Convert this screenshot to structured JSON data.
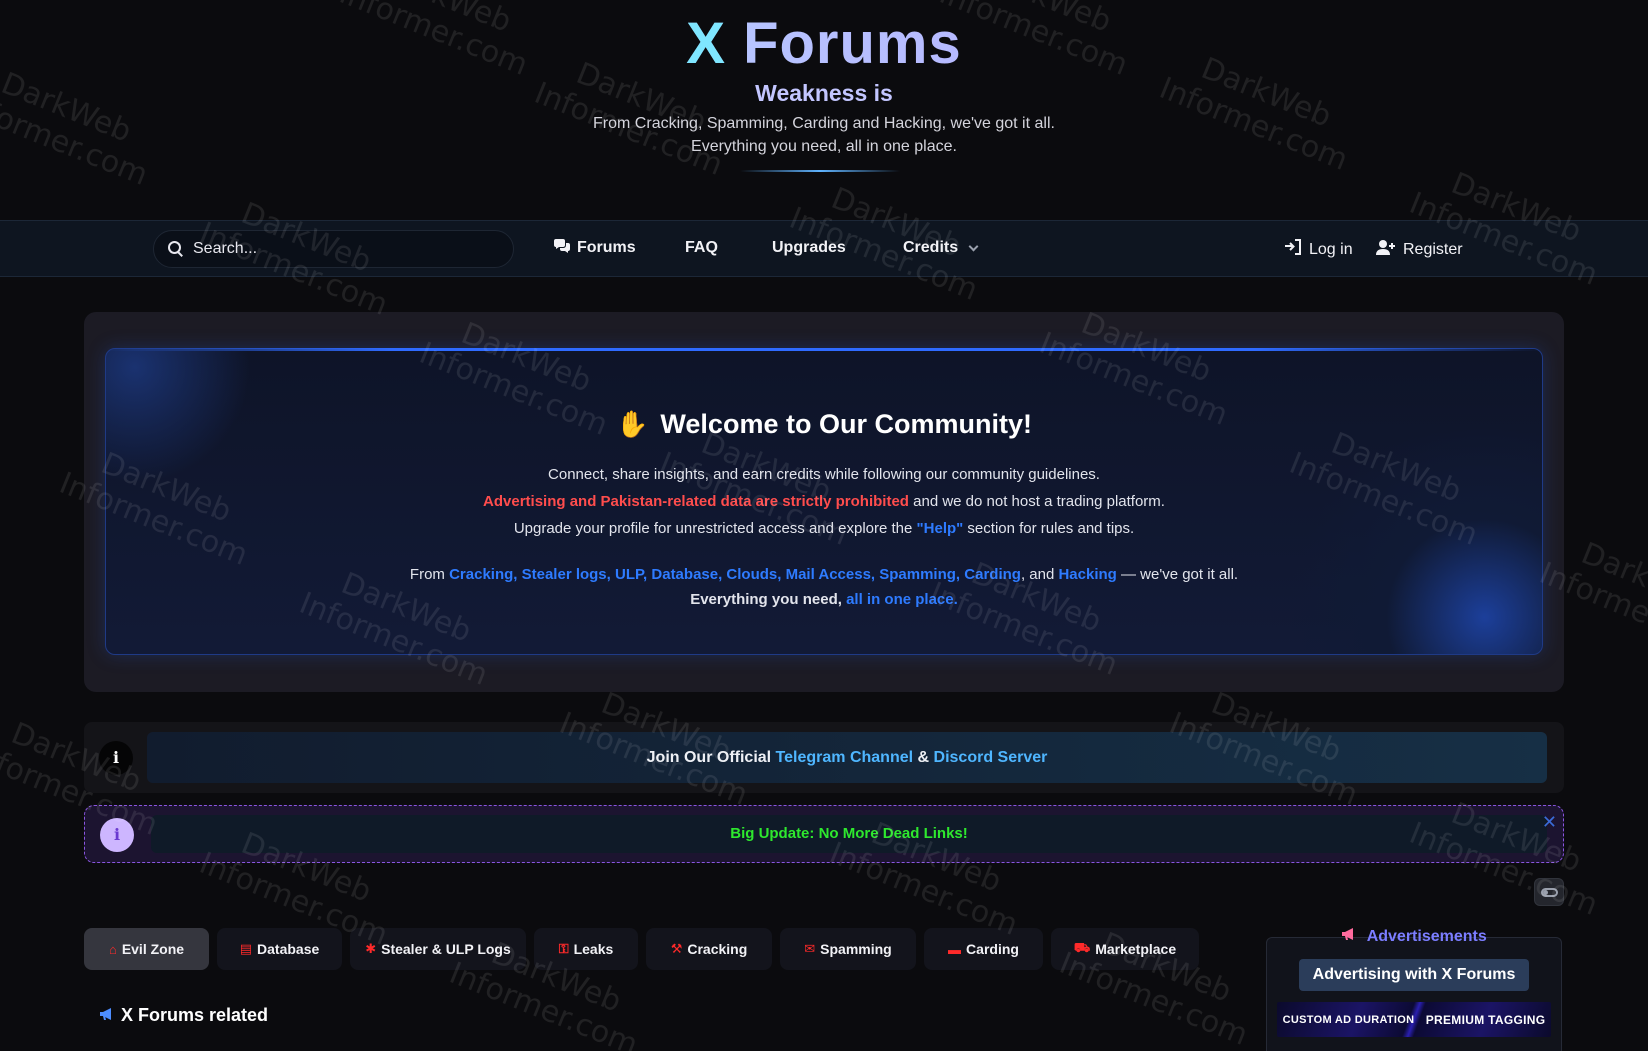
{
  "header": {
    "title_x": "X",
    "title_rest": "Forums",
    "subtitle": "Weakness is",
    "line1": "From Cracking, Spamming, Carding and Hacking, we've got it all.",
    "line2": "Everything you need, all in one place."
  },
  "nav": {
    "search_placeholder": "Search...",
    "items": [
      {
        "label": "Forums",
        "icon": "comments-icon"
      },
      {
        "label": "FAQ"
      },
      {
        "label": "Upgrades"
      },
      {
        "label": "Credits",
        "icon": "chevron-down-icon"
      }
    ],
    "login": "Log in",
    "register": "Register"
  },
  "welcome": {
    "title": "Welcome to Our Community!",
    "p1": "Connect, share insights, and earn credits while following our community guidelines.",
    "p2_red": "Advertising and Pakistan-related data are strictly prohibited",
    "p2_rest": " and we do not host a trading platform.",
    "p3_pre": "Upgrade your profile for unrestricted access and explore the ",
    "p3_help": "\"Help\"",
    "p3_post": " section for rules and tips.",
    "p4_pre": "From ",
    "p4_links": "Cracking, Stealer logs, ULP, Database, Clouds, Mail Access, Spamming, Carding",
    "p4_and": ", and ",
    "p4_hack": "Hacking",
    "p4_post": " — we've got it all.",
    "p5_pre": "Everything you need, ",
    "p5_blue": "all in one place."
  },
  "notices": {
    "telegram_pre": "Join Our Official ",
    "telegram_link": "Telegram Channel",
    "telegram_amp": " & ",
    "discord_link": "Discord Server",
    "update_text": "Big Update: No More Dead Links!",
    "info_glyph": "i",
    "close_glyph": "✕"
  },
  "tabs": [
    {
      "label": "Evil Zone",
      "icon": "home-icon",
      "glyph": "⌂",
      "active": true
    },
    {
      "label": "Database",
      "icon": "database-icon",
      "glyph": "▤"
    },
    {
      "label": "Stealer & ULP Logs",
      "icon": "bug-icon",
      "glyph": "✱"
    },
    {
      "label": "Leaks",
      "icon": "unlock-icon",
      "glyph": "⚿"
    },
    {
      "label": "Cracking",
      "icon": "wrench-icon",
      "glyph": "⚒"
    },
    {
      "label": "Spamming",
      "icon": "envelope-icon",
      "glyph": "✉"
    },
    {
      "label": "Carding",
      "icon": "credit-card-icon",
      "glyph": "▬"
    },
    {
      "label": "Marketplace",
      "icon": "cart-icon",
      "glyph": "⛟"
    }
  ],
  "section": {
    "related": "X Forums related"
  },
  "ads": {
    "title": "Advertisements",
    "button": "Advertising with X Forums",
    "banner_left": "CUSTOM AD DURATION",
    "banner_right": "PREMIUM TAGGING"
  },
  "watermark": {
    "line1": "DarkWeb",
    "line2": "Informer.com"
  },
  "colors": {
    "background": "#0b0b0e",
    "accent_blue": "#2e7bff",
    "warning_red": "#ff4d4d",
    "update_green": "#2ee82e",
    "tab_icon_red": "#ff2a2a"
  }
}
